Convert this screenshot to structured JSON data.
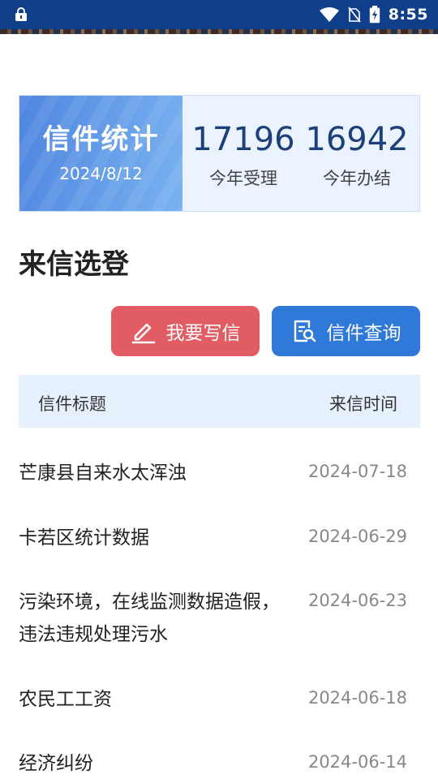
{
  "status_bar": {
    "time": "8:55",
    "icons": [
      "lock-icon",
      "wifi-icon",
      "no-sim-icon",
      "battery-charging-icon"
    ]
  },
  "stats": {
    "title": "信件统计",
    "date": "2024/8/12",
    "accepted_value": "17196",
    "accepted_label": "今年受理",
    "completed_value": "16942",
    "completed_label": "今年办结"
  },
  "section": {
    "title": "来信选登"
  },
  "actions": {
    "write_label": "我要写信",
    "write_icon": "pencil-icon",
    "query_label": "信件查询",
    "query_icon": "document-search-icon"
  },
  "table": {
    "col_title": "信件标题",
    "col_time": "来信时间",
    "rows": [
      {
        "title": "芒康县自来水太浑浊",
        "date": "2024-07-18"
      },
      {
        "title": "卡若区统计数据",
        "date": "2024-06-29"
      },
      {
        "title": "污染环境，在线监测数据造假，违法违规处理污水",
        "date": "2024-06-23"
      },
      {
        "title": "农民工工资",
        "date": "2024-06-18"
      },
      {
        "title": "经济纠纷",
        "date": "2024-06-14"
      }
    ]
  },
  "colors": {
    "status_bar": "#0f3e8a",
    "write_button": "#e25d63",
    "query_button": "#2f7ad9",
    "stat_value": "#1d3f7a",
    "header_bg": "#e6f0fc"
  }
}
